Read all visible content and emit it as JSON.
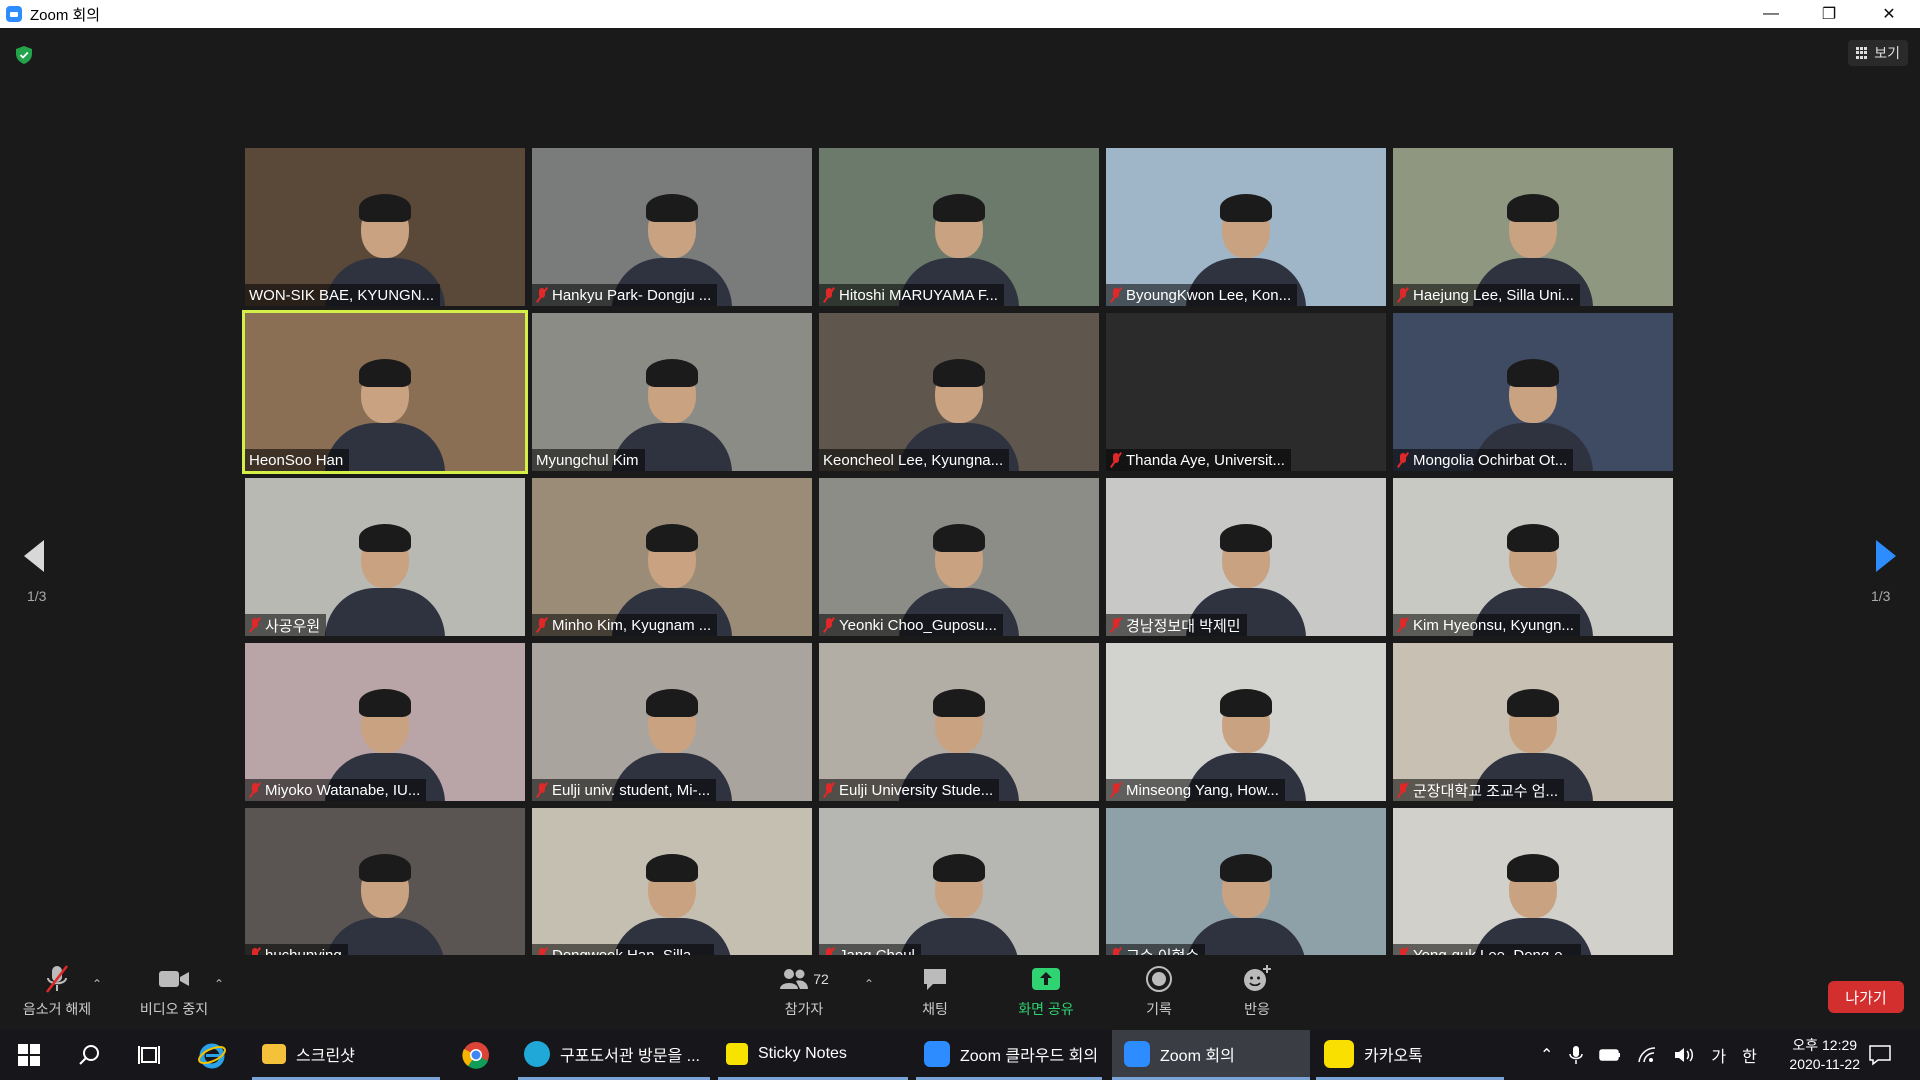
{
  "window": {
    "title": "Zoom 회의"
  },
  "meeting": {
    "view_label": "보기",
    "page_indicator_left": "1/3",
    "page_indicator_right": "1/3",
    "participants": [
      {
        "name": "WON-SIK BAE, KYUNGN...",
        "muted": false,
        "bg": "#5a4838"
      },
      {
        "name": "Hankyu Park- Dongju ...",
        "muted": true,
        "bg": "#7a7c7c"
      },
      {
        "name": "Hitoshi MARUYAMA F...",
        "muted": true,
        "bg": "#6b7a6a"
      },
      {
        "name": "ByoungKwon Lee, Kon...",
        "muted": true,
        "bg": "#9fb6c8"
      },
      {
        "name": "Haejung Lee, Silla Uni...",
        "muted": true,
        "bg": "#8f9780"
      },
      {
        "name": "HeonSoo Han",
        "muted": false,
        "bg": "#8a6f55",
        "active": true
      },
      {
        "name": "Myungchul Kim",
        "muted": false,
        "bg": "#8c8c86"
      },
      {
        "name": "Keoncheol Lee, Kyungna...",
        "muted": false,
        "bg": "#5f574e"
      },
      {
        "name": "Thanda Aye, Universit...",
        "muted": true,
        "bg": "#2b2b2b",
        "no_video": true
      },
      {
        "name": "Mongolia Ochirbat Ot...",
        "muted": true,
        "bg": "#3f4a63"
      },
      {
        "name": "사공우원",
        "muted": true,
        "bg": "#b9b9b4"
      },
      {
        "name": "Minho Kim, Kyugnam ...",
        "muted": true,
        "bg": "#9b8c78"
      },
      {
        "name": "Yeonki Choo_Guposu...",
        "muted": true,
        "bg": "#8d8d88"
      },
      {
        "name": "경남정보대 박제민",
        "muted": true,
        "bg": "#c8c8c6"
      },
      {
        "name": "Kim Hyeonsu, Kyungn...",
        "muted": true,
        "bg": "#c9c9c4"
      },
      {
        "name": "Miyoko Watanabe, IU...",
        "muted": true,
        "bg": "#b9a5a8"
      },
      {
        "name": "Eulji univ. student, Mi-...",
        "muted": true,
        "bg": "#a9a49d"
      },
      {
        "name": "Eulji University Stude...",
        "muted": true,
        "bg": "#b3aea5"
      },
      {
        "name": "Minseong Yang, How...",
        "muted": true,
        "bg": "#d2d2cf"
      },
      {
        "name": "군장대학교 조교수 엄...",
        "muted": true,
        "bg": "#c8c0b2"
      },
      {
        "name": "huchunying",
        "muted": true,
        "bg": "#5a5552"
      },
      {
        "name": "Dongwook Han_Silla ...",
        "muted": true,
        "bg": "#c5bfb2"
      },
      {
        "name": "Jang Cheul",
        "muted": true,
        "bg": "#b6b6b2"
      },
      {
        "name": "교수 이형수",
        "muted": true,
        "bg": "#8ea0a8"
      },
      {
        "name": "Yong-guk Lee, Dong-e...",
        "muted": true,
        "bg": "#d2d0cb"
      }
    ]
  },
  "toolbar": {
    "unmute_label": "음소거 해제",
    "video_label": "비디오 중지",
    "participants_label": "참가자",
    "participants_count": "72",
    "chat_label": "채팅",
    "share_label": "화면 공유",
    "record_label": "기록",
    "reactions_label": "반응",
    "leave_label": "나가기",
    "share_color": "#2fd372",
    "leave_color": "#d32f2f"
  },
  "taskbar": {
    "items": [
      {
        "label": "스크린샷"
      },
      {
        "label": "구포도서관 방문을 ..."
      },
      {
        "label": "Sticky Notes"
      },
      {
        "label": "Zoom 클라우드 회의"
      },
      {
        "label": "Zoom 회의"
      },
      {
        "label": "카카오톡"
      }
    ],
    "ime_mode": "가",
    "ime_lang": "한",
    "time": "오후 12:29",
    "date": "2020-11-22"
  }
}
